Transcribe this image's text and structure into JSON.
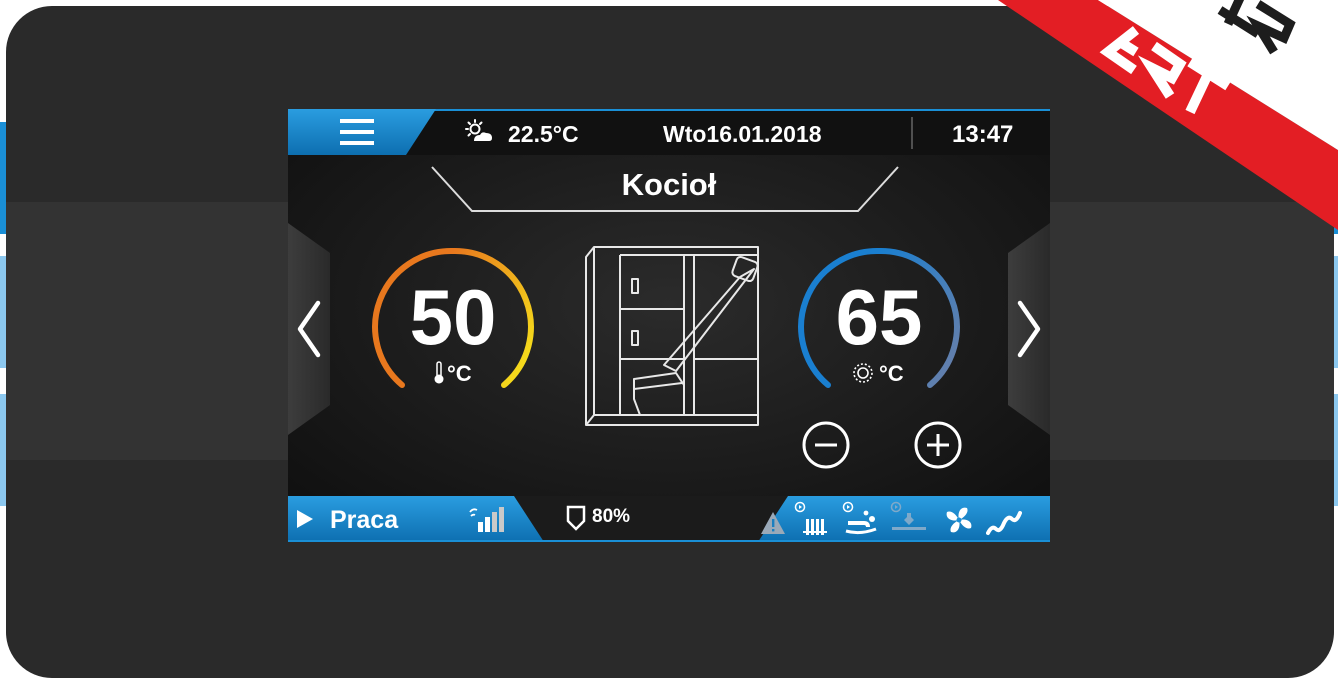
{
  "header": {
    "menu_icon": "hamburger-icon",
    "weather_icon": "partly-sunny-icon",
    "outdoor_temp": "22.5°C",
    "date": "Wto16.01.2018",
    "time": "13:47"
  },
  "title": "Kocioł",
  "left_gauge": {
    "value": "50",
    "unit": "°C",
    "icon": "thermometer-icon"
  },
  "right_gauge": {
    "value": "65",
    "unit": "°C",
    "icon": "setpoint-dial-icon"
  },
  "controls": {
    "minus_icon": "minus-circle-icon",
    "plus_icon": "plus-circle-icon",
    "prev_icon": "chevron-left-icon",
    "next_icon": "chevron-right-icon"
  },
  "status": {
    "play_icon": "play-icon",
    "mode": "Praca",
    "signal_icon": "signal-bars-icon",
    "fuel_icon": "fuel-hopper-icon",
    "fuel_level": "80%",
    "icons": [
      "warning-icon",
      "radiator-pump-icon",
      "hot-water-pump-icon",
      "circulation-pump-icon",
      "fan-icon",
      "feeder-icon"
    ]
  },
  "colors": {
    "accent_blue": "#1a8fd6",
    "gauge_left_start": "#e8781e",
    "gauge_left_end": "#f7e81b",
    "gauge_right_start": "#1a7fd0",
    "gauge_right_end": "#6b7fa8",
    "ribbon_red": "#e31e24"
  }
}
